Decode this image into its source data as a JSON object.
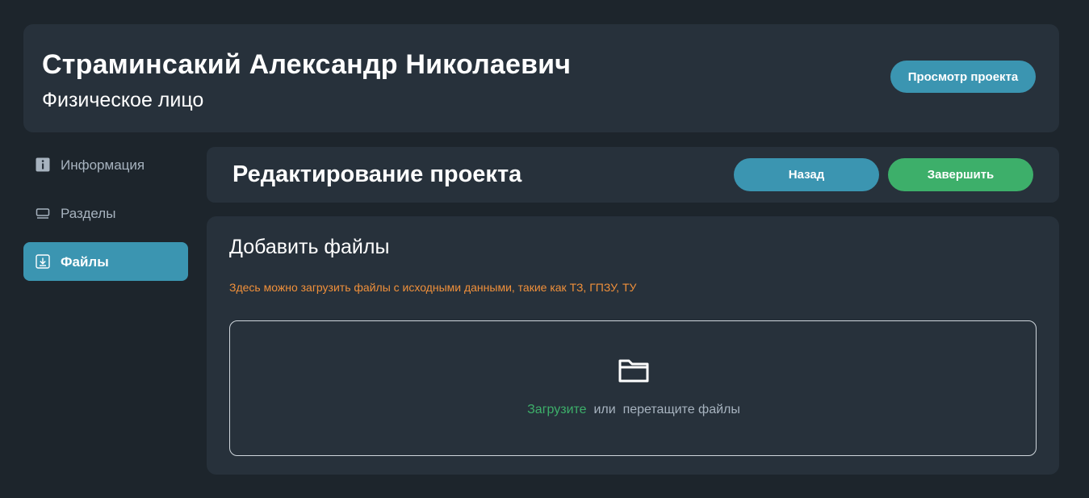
{
  "header": {
    "name": "Страминсакий Александр Николаевич",
    "subtitle": "Физическое лицо",
    "preview_button": "Просмотр проекта"
  },
  "sidebar": {
    "items": [
      {
        "label": "Информация",
        "icon": "info-icon",
        "active": false
      },
      {
        "label": "Разделы",
        "icon": "sections-icon",
        "active": false
      },
      {
        "label": "Файлы",
        "icon": "download-icon",
        "active": true
      }
    ]
  },
  "edit": {
    "title": "Редактирование проекта",
    "back_button": "Назад",
    "finish_button": "Завершить"
  },
  "files": {
    "title": "Добавить файлы",
    "hint": "Здесь можно загрузить файлы с исходными данными, такие как ТЗ, ГПЗУ, ТУ",
    "dropzone": {
      "upload_link": "Загрузите",
      "or_text": "или",
      "drag_text": "перетащите файлы",
      "icon": "folder-icon"
    }
  },
  "colors": {
    "background": "#1d252c",
    "card": "#27313b",
    "accent_blue": "#3b95b1",
    "accent_green": "#3daf6a",
    "hint_orange": "#f0903b",
    "muted_text": "#a7b3bf"
  }
}
